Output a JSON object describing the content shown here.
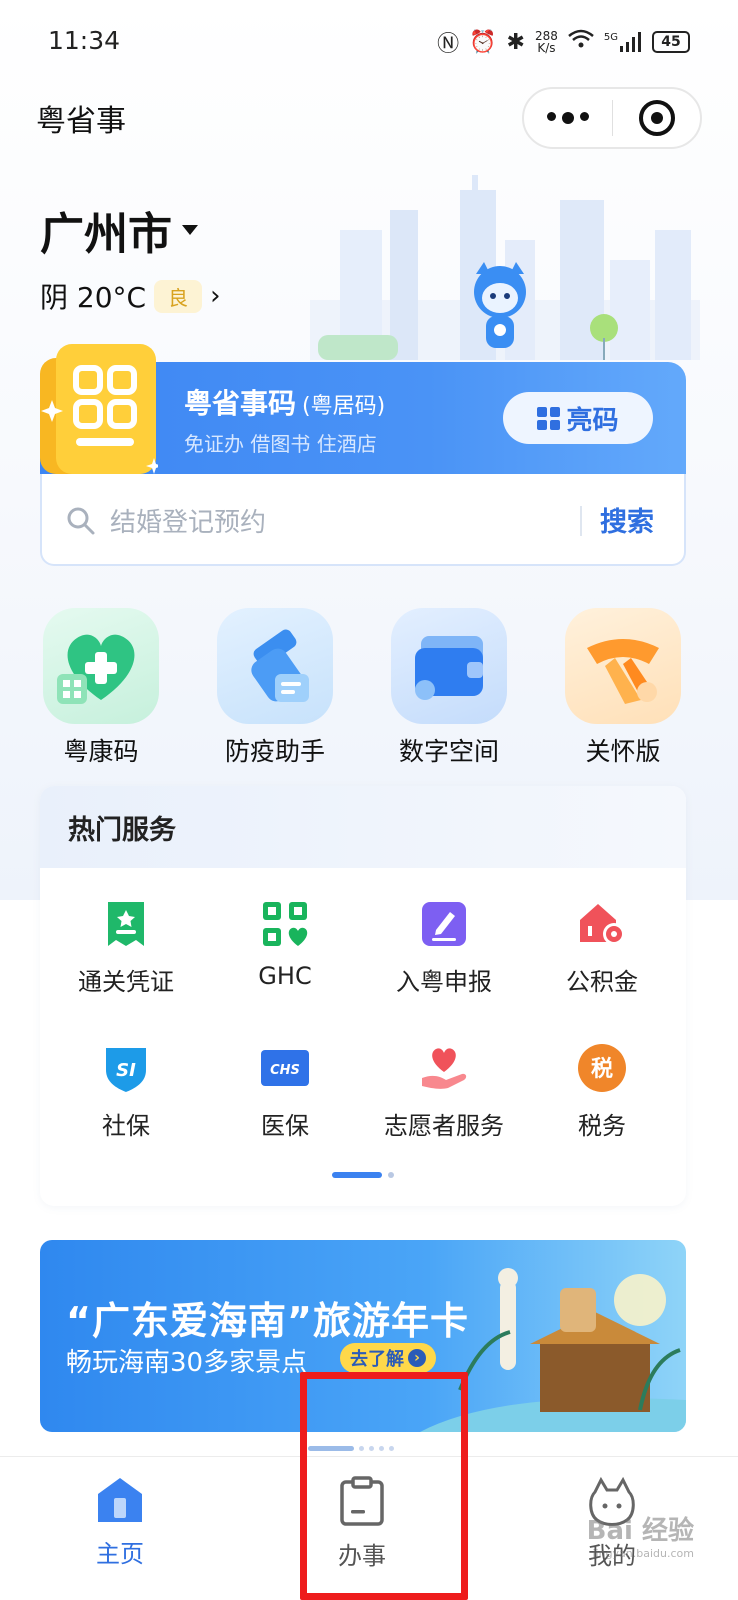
{
  "status_bar": {
    "time": "11:34",
    "net_speed_value": "288",
    "net_speed_unit": "K/s",
    "signal_label": "5G",
    "battery": "45"
  },
  "header": {
    "app_title": "粤省事"
  },
  "location": {
    "city": "广州市",
    "weather": "阴 20°C",
    "aqi": "良"
  },
  "code_banner": {
    "title": "粤省事码",
    "subtitle": "(粤居码)",
    "description": "免证办 借图书 住酒店",
    "button_label": "亮码"
  },
  "search": {
    "placeholder": "结婚登记预约",
    "button_label": "搜索"
  },
  "quick_apps": [
    {
      "label": "粤康码",
      "icon": "heart-plus-icon",
      "color": "#35c98a"
    },
    {
      "label": "防疫助手",
      "icon": "spray-icon",
      "color": "#3b8ef0"
    },
    {
      "label": "数字空间",
      "icon": "wallet-icon",
      "color": "#2f7df0"
    },
    {
      "label": "关怀版",
      "icon": "scarf-icon",
      "color": "#ff9a2e"
    }
  ],
  "hot_services": {
    "title": "热门服务",
    "items": [
      {
        "label": "通关凭证",
        "icon": "pass-ticket-icon",
        "color": "#1fb86a"
      },
      {
        "label": "GHC",
        "icon": "ghc-qr-icon",
        "color": "#19b45c"
      },
      {
        "label": "入粤申报",
        "icon": "pen-square-icon",
        "color": "#7d5ff2"
      },
      {
        "label": "公积金",
        "icon": "house-coin-icon",
        "color": "#f0525a"
      },
      {
        "label": "社保",
        "icon": "si-shield-icon",
        "color": "#1d9be8",
        "badge": "SI"
      },
      {
        "label": "医保",
        "icon": "chs-card-icon",
        "color": "#2f72e8",
        "badge": "CHS"
      },
      {
        "label": "志愿者服务",
        "icon": "hand-heart-icon",
        "color": "#f0525a"
      },
      {
        "label": "税务",
        "icon": "tax-circle-icon",
        "color": "#f0862a",
        "badge": "税"
      }
    ]
  },
  "promo": {
    "title": "“广东爱海南”旅游年卡",
    "subtitle": "畅玩海南30多家景点",
    "button_label": "去了解"
  },
  "tabbar": {
    "tabs": [
      {
        "label": "主页",
        "active": true
      },
      {
        "label": "办事",
        "active": false
      },
      {
        "label": "我的",
        "active": false
      }
    ]
  },
  "watermark": {
    "brand": "Bai 经验",
    "url": "jingyan.baidu.com"
  },
  "colors": {
    "accent": "#2f6fe0",
    "highlight": "#ee1c1c"
  }
}
